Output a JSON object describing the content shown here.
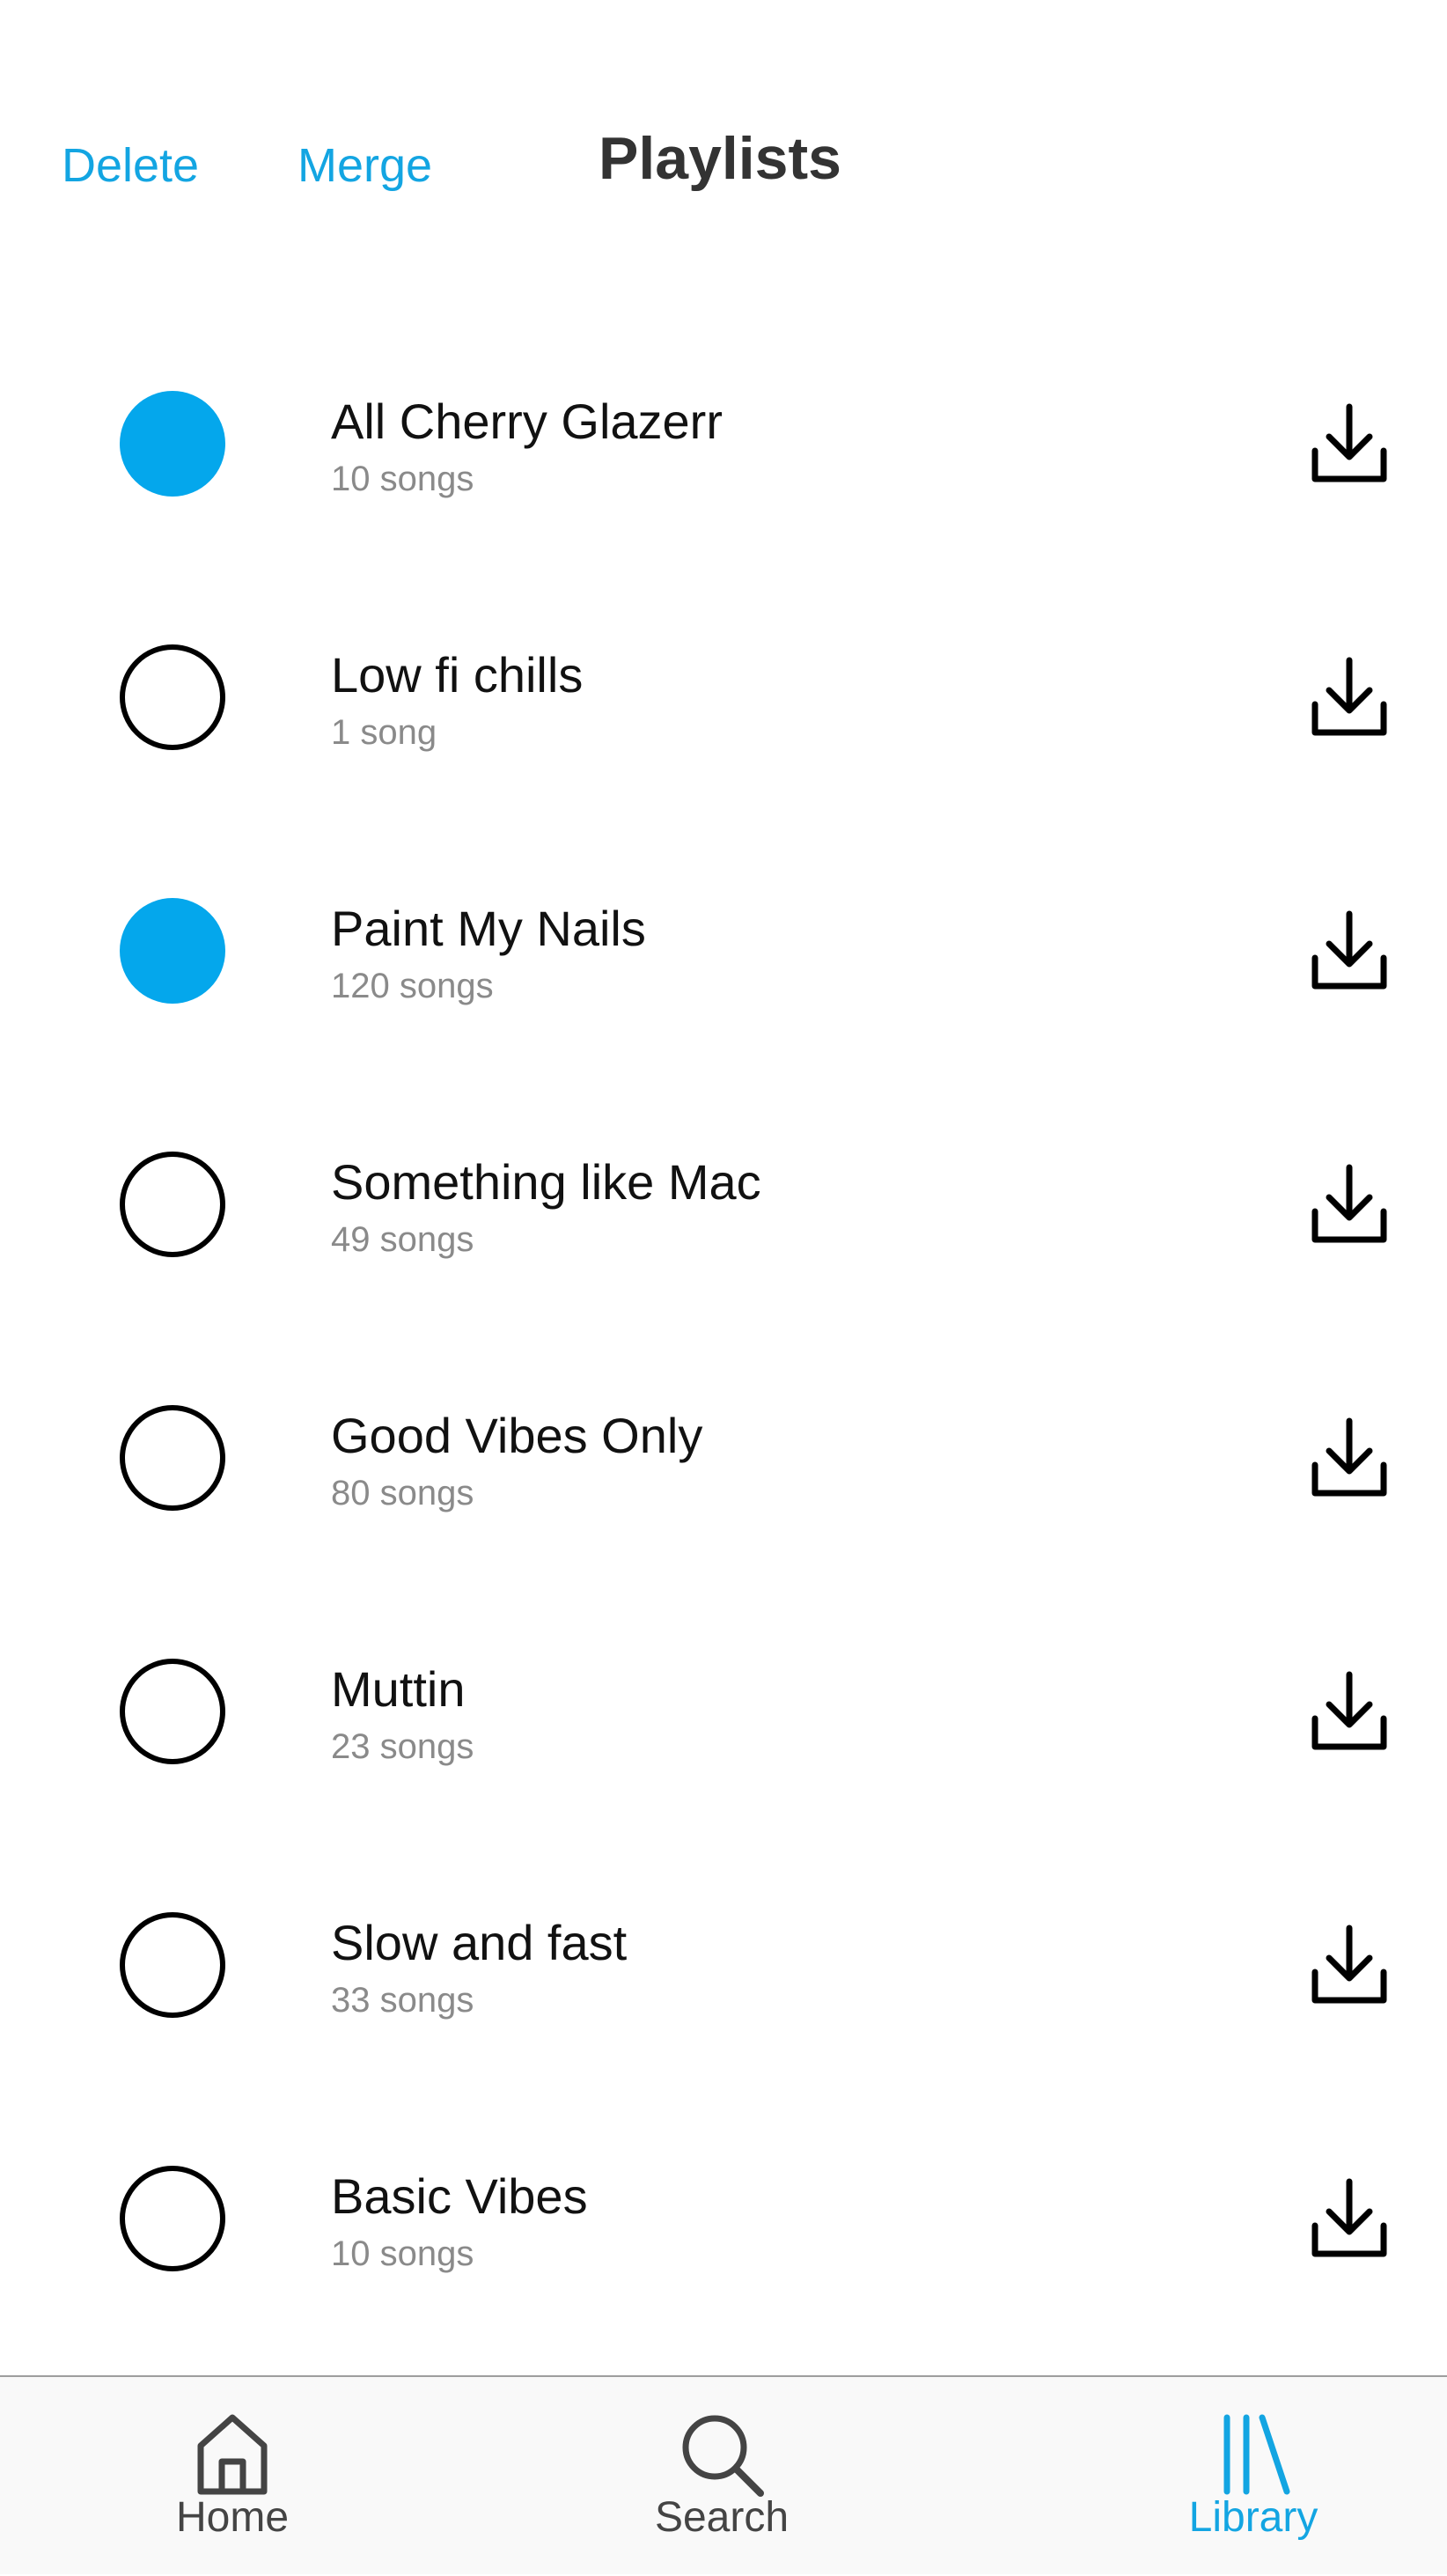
{
  "header": {
    "delete_label": "Delete",
    "merge_label": "Merge",
    "title": "Playlists"
  },
  "colors": {
    "accent": "#13a5e2",
    "selected_fill": "#04a7ec",
    "secondary_text": "#8a8a8a"
  },
  "playlists": [
    {
      "name": "All Cherry Glazerr",
      "count": "10 songs",
      "selected": true
    },
    {
      "name": "Low fi chills",
      "count": "1 song",
      "selected": false
    },
    {
      "name": "Paint My Nails",
      "count": "120 songs",
      "selected": true
    },
    {
      "name": "Something like Mac",
      "count": "49 songs",
      "selected": false
    },
    {
      "name": "Good Vibes Only",
      "count": "80 songs",
      "selected": false
    },
    {
      "name": "Muttin",
      "count": "23 songs",
      "selected": false
    },
    {
      "name": "Slow and fast",
      "count": "33 songs",
      "selected": false
    },
    {
      "name": "Basic Vibes",
      "count": "10 songs",
      "selected": false
    }
  ],
  "row_icon": "download-icon",
  "tabbar": {
    "items": [
      {
        "label": "Home",
        "icon": "home-icon",
        "active": false
      },
      {
        "label": "Search",
        "icon": "search-icon",
        "active": false
      },
      {
        "label": "Library",
        "icon": "library-icon",
        "active": true
      }
    ]
  }
}
